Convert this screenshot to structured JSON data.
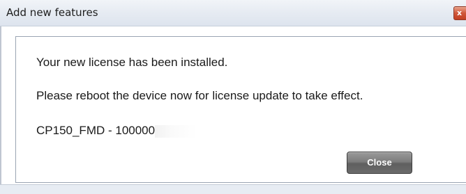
{
  "window": {
    "title": "Add new features",
    "close_glyph": "x"
  },
  "messages": {
    "line1": "Your new license has been installed.",
    "line2": "Please reboot the device now for license update to take effect.",
    "license_id": "CP150_FMD - 100000"
  },
  "buttons": {
    "close_label": "Close"
  },
  "colors": {
    "close_button": "#6b6b6b",
    "titlebar": "#e6ebf2",
    "window_close": "#c23f22"
  }
}
